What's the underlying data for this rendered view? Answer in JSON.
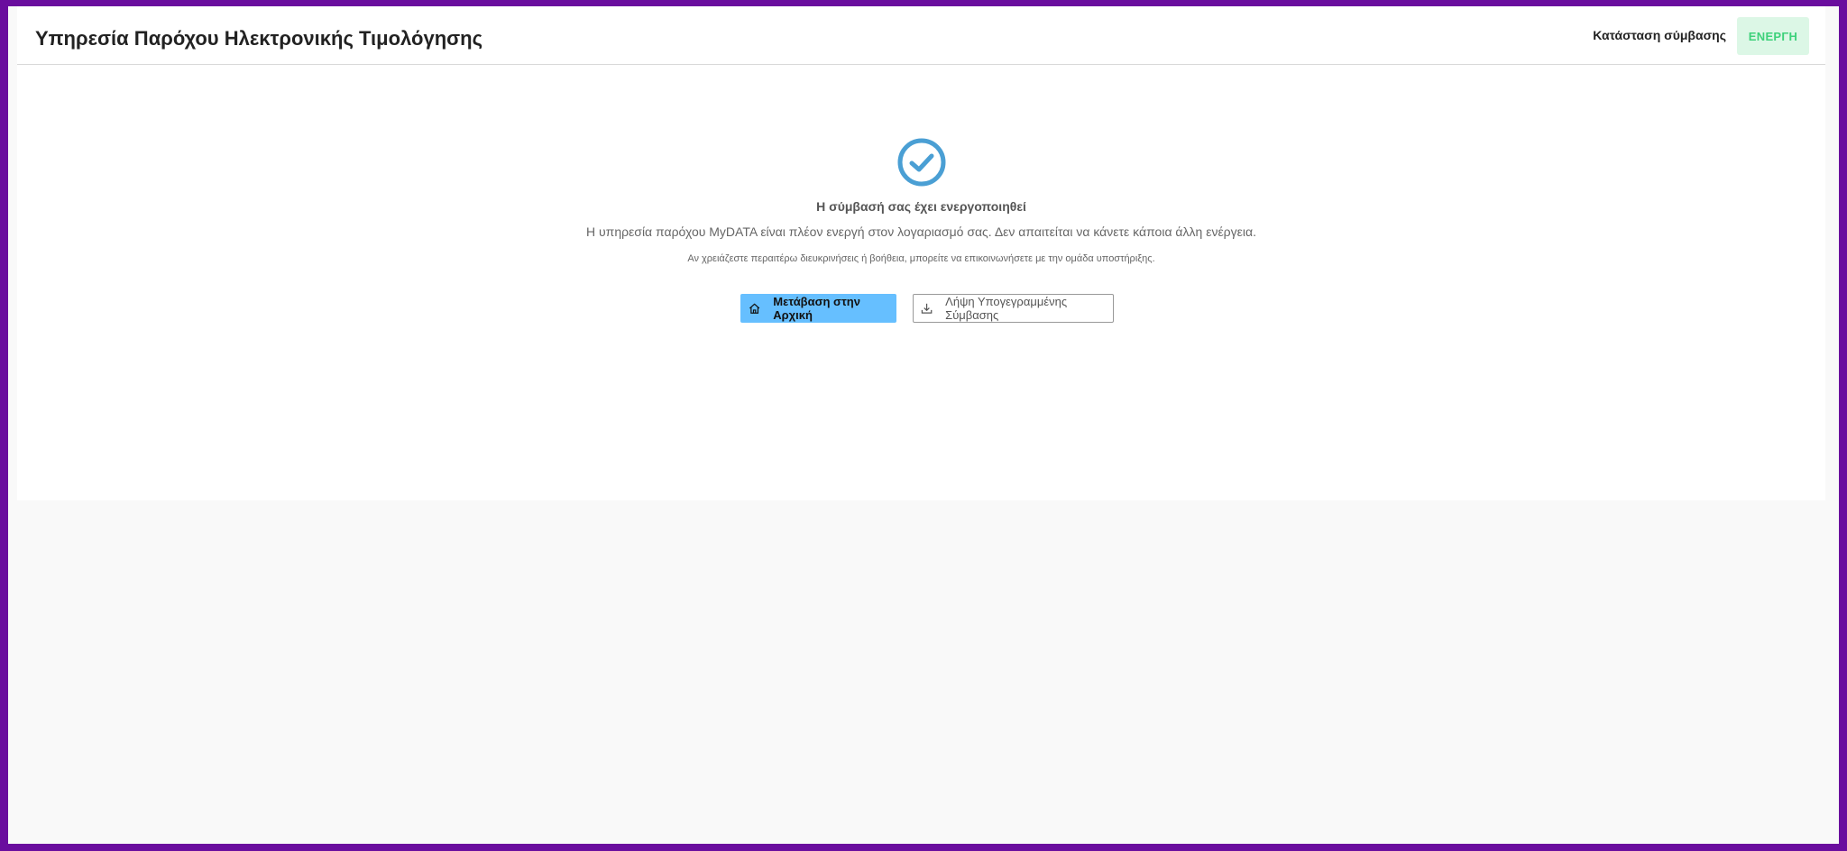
{
  "header": {
    "title": "Υπηρεσία Παρόχου Ηλεκτρονικής Τιμολόγησης",
    "status_label": "Κατάσταση σύμβασης",
    "status_badge": "ΕΝΕΡΓΗ"
  },
  "content": {
    "icon": "check-circle-icon",
    "heading": "Η σύμβασή σας έχει ενεργοποιηθεί",
    "description": "Η υπηρεσία παρόχου MyDATA είναι πλέον ενεργή στον λογαριασμό σας. Δεν απαιτείται να κάνετε κάποια άλλη ενέργεια.",
    "help": "Αν χρειάζεστε περαιτέρω διευκρινήσεις ή βοήθεια, μπορείτε να επικοινωνήσετε με την ομάδα υποστήριξης."
  },
  "actions": {
    "home_label": "Μετάβαση στην Αρχική",
    "home_icon": "home-icon",
    "download_label": "Λήψη Υπογεγραμμένης Σύμβασης",
    "download_icon": "download-icon"
  },
  "colors": {
    "accent": "#66bfff",
    "success_icon": "#4a9fd4",
    "badge_bg": "#dcf7e6",
    "badge_text": "#3dd17a",
    "frame": "#6a0d9e"
  }
}
